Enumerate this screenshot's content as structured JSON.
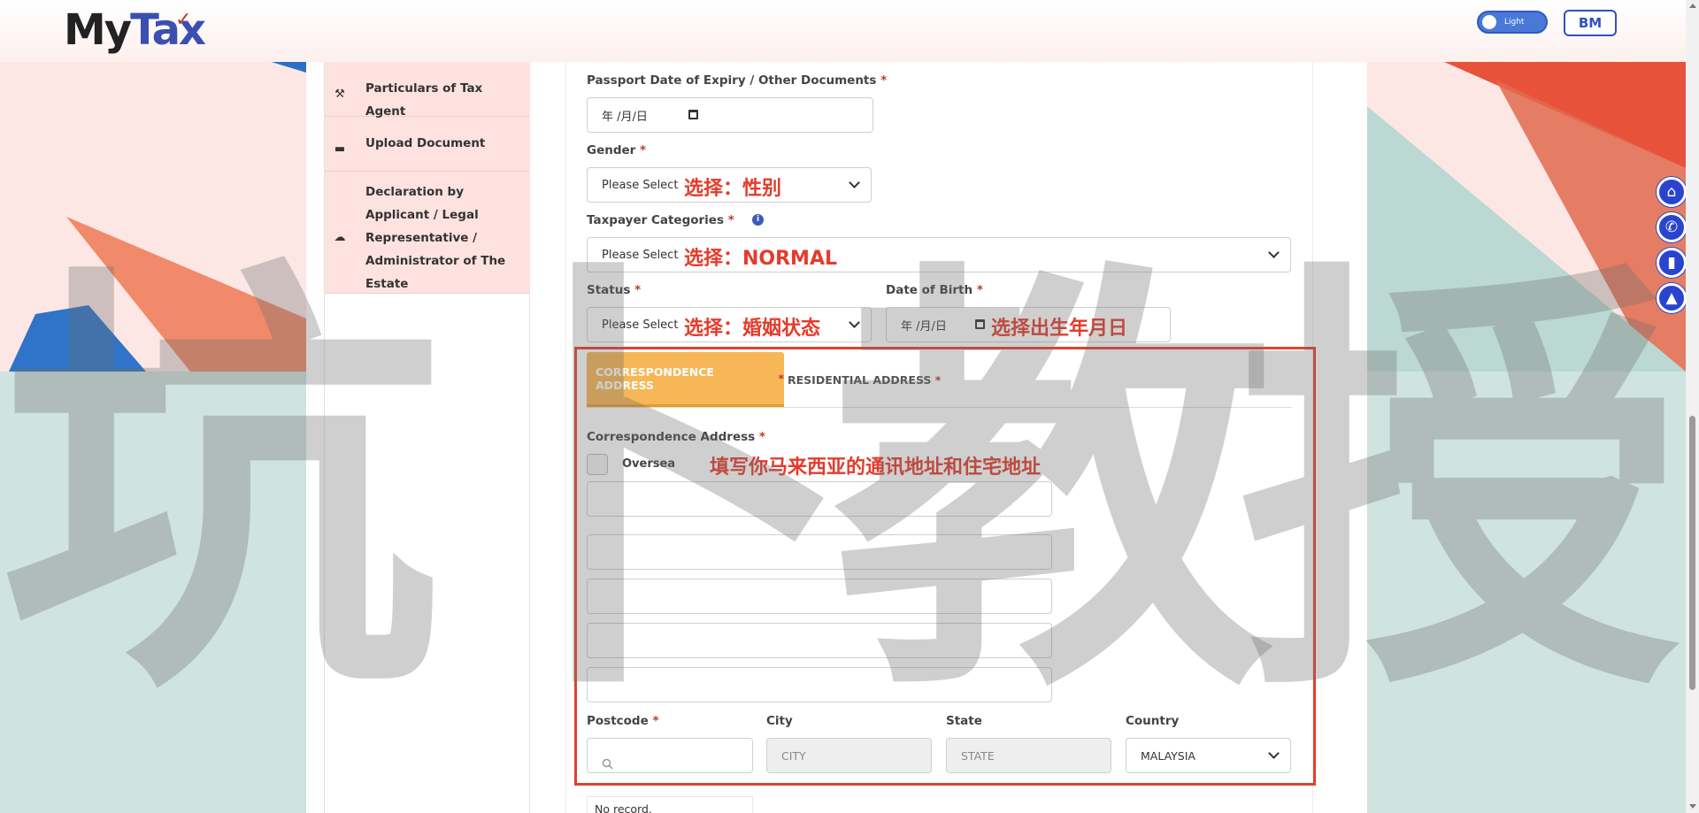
{
  "header": {
    "logo_my": "My",
    "logo_tax": "Tax",
    "theme_toggle_label": "Light",
    "language_button": "BM"
  },
  "sidebar": {
    "items": [
      {
        "label": "Particulars of Tax Agent",
        "icon": "gavel-icon"
      },
      {
        "label": "Upload Document",
        "icon": "folder-icon"
      },
      {
        "label": "Declaration by Applicant / Legal Representative / Administrator of The Estate",
        "icon": "cloud-upload-icon"
      }
    ]
  },
  "form": {
    "passport_expiry": {
      "label": "Passport Date of Expiry / Other Documents",
      "required": "*",
      "placeholder": "年 /月/日"
    },
    "gender": {
      "label": "Gender",
      "required": "*",
      "value": "Please Select"
    },
    "taxpayer_categories": {
      "label": "Taxpayer Categories",
      "required": "*",
      "value": "Please Select"
    },
    "status": {
      "label": "Status",
      "required": "*",
      "value": "Please Select"
    },
    "date_of_birth": {
      "label": "Date of Birth",
      "required": "*",
      "placeholder": "年 /月/日"
    },
    "address_tabs": [
      {
        "label": "CORRESPONDENCE ADDRESS",
        "required": "*",
        "active": true
      },
      {
        "label": "RESIDENTIAL ADDRESS",
        "required": "*",
        "active": false
      }
    ],
    "correspondence_label": "Correspondence Address",
    "correspondence_required": "*",
    "oversea_label": "Oversea",
    "postcode": {
      "label": "Postcode",
      "required": "*"
    },
    "city": {
      "label": "City",
      "placeholder": "CITY"
    },
    "state": {
      "label": "State",
      "placeholder": "STATE"
    },
    "country": {
      "label": "Country",
      "value": "MALAYSIA"
    },
    "no_record": "No record."
  },
  "annotations": {
    "gender": "选择：性别",
    "taxpayer": "选择：NORMAL",
    "status": "选择：婚姻状态",
    "dob": "选择出生年月日",
    "address": "填写你马来西亚的通讯地址和住宅地址"
  },
  "watermark": [
    "坑",
    "卜",
    "教",
    "授"
  ],
  "fab_buttons": [
    "home-icon",
    "megaphone-icon",
    "book-icon",
    "graduation-cap-icon"
  ],
  "colors": {
    "accent": "#2a44cf",
    "annotation_red": "#e53b2c",
    "active_tab": "#f7b756",
    "sidebar_bg": "#fde2e0"
  }
}
